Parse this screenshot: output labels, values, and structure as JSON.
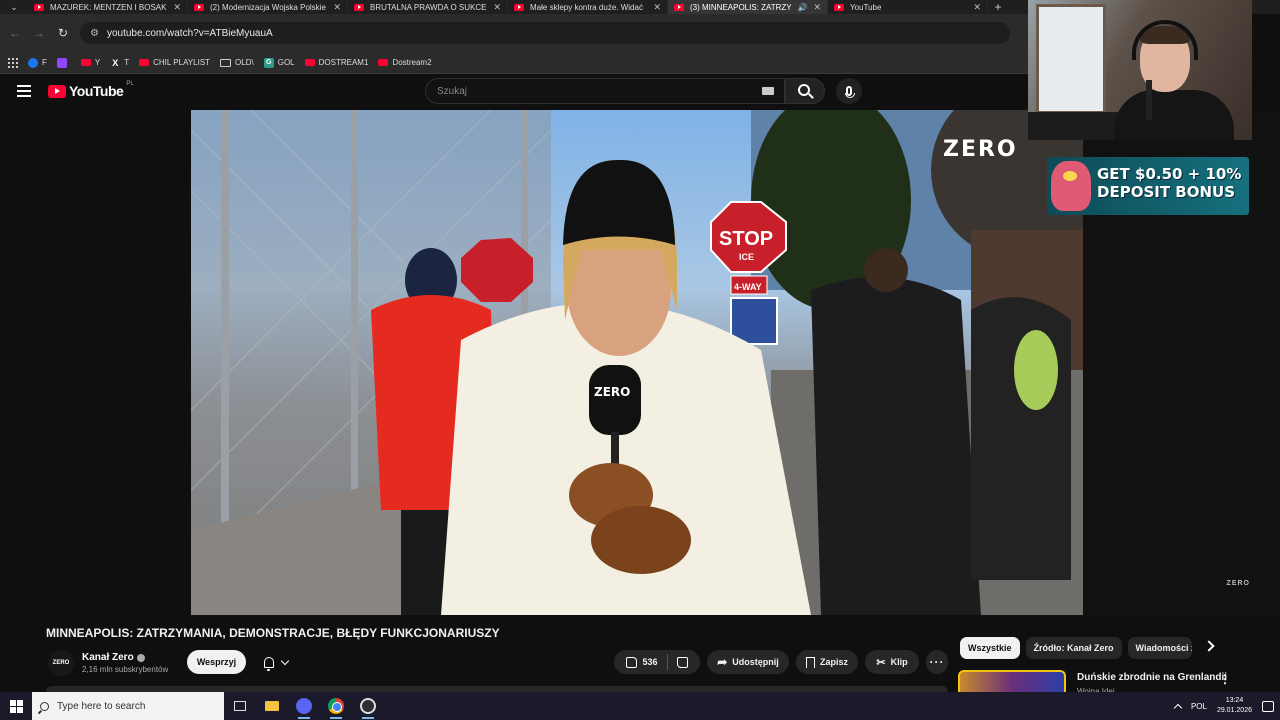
{
  "browser": {
    "tabs": [
      {
        "title": "MAZUREK: MENTZEN I BOSAK",
        "active": false
      },
      {
        "title": "(2) Modernizacja Wojska Polskie",
        "active": false
      },
      {
        "title": "BRUTALNA PRAWDA O SUKCES",
        "active": false
      },
      {
        "title": "Małe sklepy kontra duże. Widać",
        "active": false
      },
      {
        "title": "(3) MINNEAPOLIS: ZATRZY",
        "active": true,
        "audio": true
      },
      {
        "title": "YouTube",
        "active": false
      }
    ],
    "new_tab": "+",
    "url": "youtube.com/watch?v=ATBieMyuauA",
    "bookmarks": [
      {
        "label": "F",
        "icon": "facebook-icon"
      },
      {
        "label": "",
        "icon": "twitch-icon"
      },
      {
        "label": "Y",
        "icon": "youtube-icon"
      },
      {
        "label": "T",
        "icon": "x-icon"
      },
      {
        "label": "CHIL PLAYLIST",
        "icon": "youtube-icon"
      },
      {
        "label": "OLD\\",
        "icon": "folder-icon"
      },
      {
        "label": "GOL",
        "icon": "g-icon"
      },
      {
        "label": "DOSTREAM1",
        "icon": "youtube-icon"
      },
      {
        "label": "Dostream2",
        "icon": "youtube-icon"
      }
    ]
  },
  "youtube": {
    "logo_text": "YouTube",
    "country": "PL",
    "search_placeholder": "Szukaj"
  },
  "video": {
    "watermark": "ZERO",
    "corner_mark": "ZERO",
    "title": "MINNEAPOLIS: ZATRZYMANIA, DEMONSTRACJE, BŁĘDY FUNKCJONARIUSZY",
    "channel_name": "Kanał Zero",
    "channel_avatar": "ZERO",
    "subscribers": "2,16 mln subskrybentów",
    "support_label": "Wesprzyj",
    "likes": "536",
    "share_label": "Udostępnij",
    "save_label": "Zapisz",
    "clip_label": "Klip",
    "more_label": "···"
  },
  "overlay": {
    "bonus_line1": "GET $0.50 + 10%",
    "bonus_line2": "DEPOSIT BONUS"
  },
  "chips": [
    "Wszystkie",
    "Źródło: Kanał Zero",
    "Wiadomości z"
  ],
  "recommendation": {
    "title": "Duńskie zbrodnie na Grenlandii",
    "subtitle": "Wojna Idei"
  },
  "taskbar": {
    "search_placeholder": "Type here to search",
    "language": "POL",
    "time": "13:24",
    "date": "29.01.2026"
  },
  "colors": {
    "youtube_red": "#ff0033",
    "background": "#0f0f0f",
    "pill": "#272727"
  }
}
